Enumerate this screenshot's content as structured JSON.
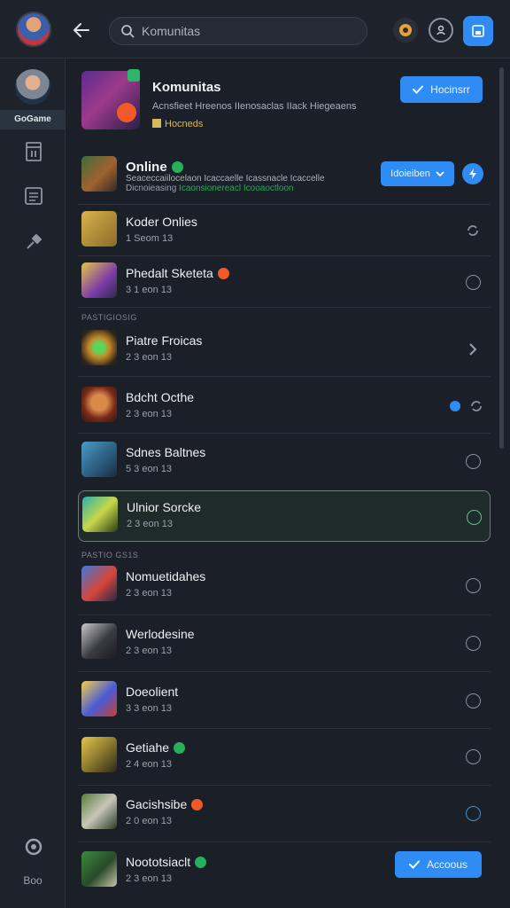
{
  "search": {
    "value": "Komunitas"
  },
  "sidebar": {
    "user_label": "GoGame",
    "bottom_label": "Boo"
  },
  "header": {
    "title": "Komunitas",
    "description": "Acnsfieet Hreenos IIenosaclas IIack Hiegeaens",
    "sub": "Hocneds",
    "button_label": "Hocinsrr"
  },
  "online": {
    "title": "Online",
    "description": "Seaceccaiilocelaon Icaccaelle Icassnacle Icaccelle",
    "sub_prefix": "Dicnoieasing",
    "sub_highlight": "Icaonsionereacl Icooaoctloon",
    "button_label": "Idoieiben"
  },
  "sections": [
    "PASTIGIOSIG",
    "PASTIO GS1S"
  ],
  "items": [
    {
      "name": "Koder Onlies",
      "meta": "1 Seom 13"
    },
    {
      "name": "Phedalt Sketeta",
      "meta": "3 1 eon 13"
    },
    {
      "name": "Piatre Froicas",
      "meta": "2 3 eon 13"
    },
    {
      "name": "Bdcht Octhe",
      "meta": "2 3 eon 13"
    },
    {
      "name": "Sdnes Baltnes",
      "meta": "5 3 eon 13"
    },
    {
      "name": "Ulnior Sorcke",
      "meta": "2 3 eon 13"
    },
    {
      "name": "Nomuetidahes",
      "meta": "2 3 eon 13"
    },
    {
      "name": "Werlodesine",
      "meta": "2 3 eon 13"
    },
    {
      "name": "Doeolient",
      "meta": "3 3 eon 13"
    },
    {
      "name": "Getiahe",
      "meta": "2 4 eon 13"
    },
    {
      "name": "Gacishsibe",
      "meta": "2 0 eon 13"
    },
    {
      "name": "Noototsiaclt",
      "meta": "2 3 eon 13"
    }
  ],
  "accept_label": "Accoous",
  "colors": {
    "accent": "#2f8cf5",
    "active_check": "#4bd07a",
    "online_badge": "#27b05a"
  }
}
